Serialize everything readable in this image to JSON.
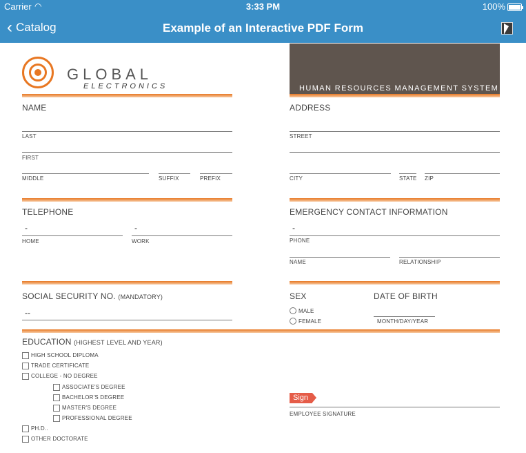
{
  "status_bar": {
    "carrier": "Carrier",
    "time": "3:33 PM",
    "battery": "100%"
  },
  "nav": {
    "back_label": "Catalog",
    "title": "Example of an Interactive PDF Form"
  },
  "logo": {
    "word1": "GLOBAL",
    "word2": "ELECTRONICS"
  },
  "banner": {
    "text": "HUMAN RESOURCES MANAGEMENT SYSTEM"
  },
  "name": {
    "title": "NAME",
    "last": "LAST",
    "first": "FIRST",
    "middle": "MIDDLE",
    "suffix": "SUFFIX",
    "prefix": "PREFIX"
  },
  "address": {
    "title": "ADDRESS",
    "street": "STREET",
    "city": "CITY",
    "state": "STATE",
    "zip": "ZIP"
  },
  "telephone": {
    "title": "TELEPHONE",
    "home": "HOME",
    "work": "WORK",
    "home_value": "-",
    "work_value": "-"
  },
  "emergency": {
    "title": "EMERGENCY CONTACT INFORMATION",
    "phone": "PHONE",
    "phone_value": "-",
    "name": "NAME",
    "relationship": "RELATIONSHIP"
  },
  "ssn": {
    "title": "SOCIAL SECURITY NO.",
    "note": "(MANDATORY)",
    "value": "--"
  },
  "sex": {
    "title": "SEX",
    "male": "MALE",
    "female": "FEMALE"
  },
  "dob": {
    "title": "DATE OF BIRTH",
    "format": "MONTH/DAY/YEAR"
  },
  "education": {
    "title": "EDUCATION",
    "note": "(HIGHEST LEVEL AND YEAR)",
    "high_school": "HIGH SCHOOL DIPLOMA",
    "trade": "TRADE CERTIFICATE",
    "college": "COLLEGE - NO DEGREE",
    "associate": "ASSOCIATE'S DEGREE",
    "bachelor": "BACHELOR'S DEGREE",
    "master": "MASTER'S DEGREE",
    "professional": "PROFESSIONAL DEGREE",
    "phd": "PH.D..",
    "other": "OTHER DOCTORATE"
  },
  "signature": {
    "tag": "Sign",
    "label": "EMPLOYEE SIGNATURE"
  },
  "colors": {
    "nav": "#3a8fc7",
    "accent": "#e87722",
    "banner": "#5f554e",
    "sign": "#e55c48"
  }
}
